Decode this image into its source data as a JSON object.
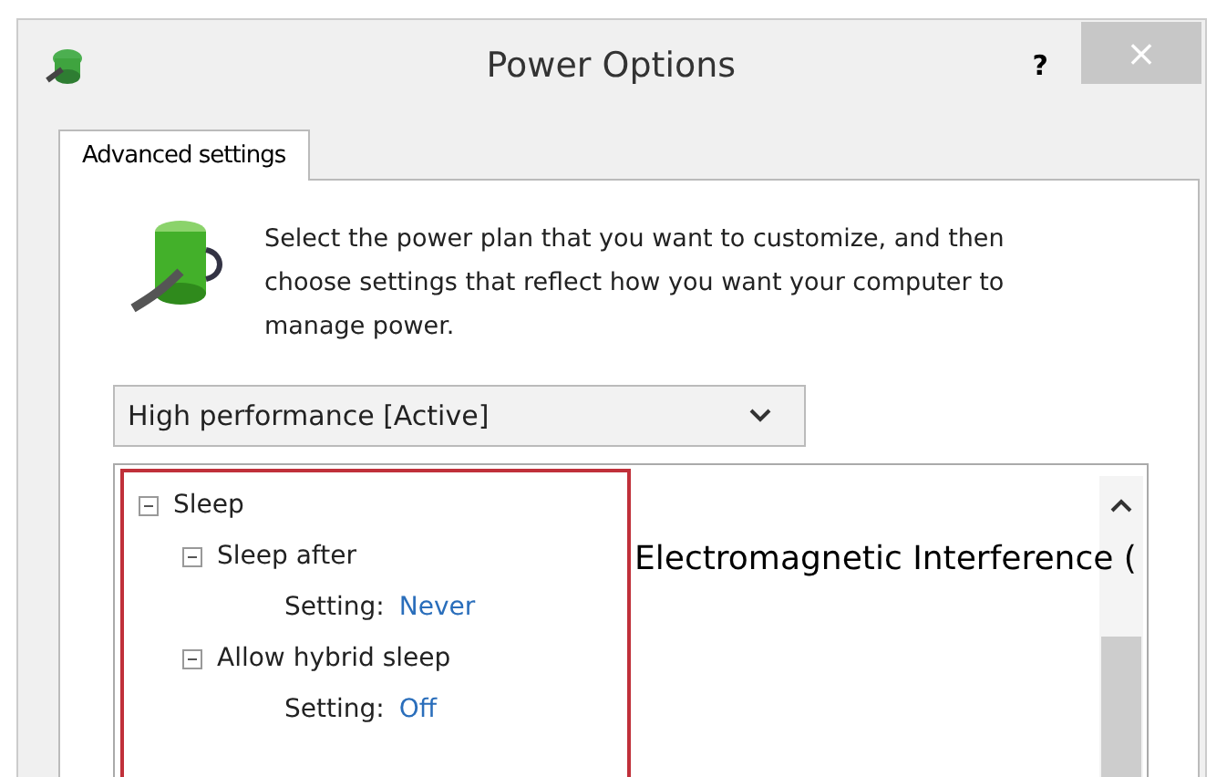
{
  "window": {
    "title": "Power Options",
    "help": "?",
    "close": "×"
  },
  "tabs": [
    {
      "label": "Advanced settings",
      "selected": true
    }
  ],
  "description": "Select the power plan that you want to customize, and then choose settings that reflect how you want your computer to manage power.",
  "plan_dropdown": {
    "value": "High performance [Active]"
  },
  "tree": [
    {
      "label": "Sleep",
      "expanded": true,
      "children": [
        {
          "label": "Sleep after",
          "expanded": true,
          "children": [
            {
              "kind": "setting",
              "label": "Setting:",
              "value": "Never"
            }
          ]
        },
        {
          "label": "Allow hybrid sleep",
          "expanded": true,
          "children": [
            {
              "kind": "setting",
              "label": "Setting:",
              "value": "Off"
            }
          ]
        }
      ]
    }
  ],
  "overlay_text": "Electromagnetic Interference ("
}
